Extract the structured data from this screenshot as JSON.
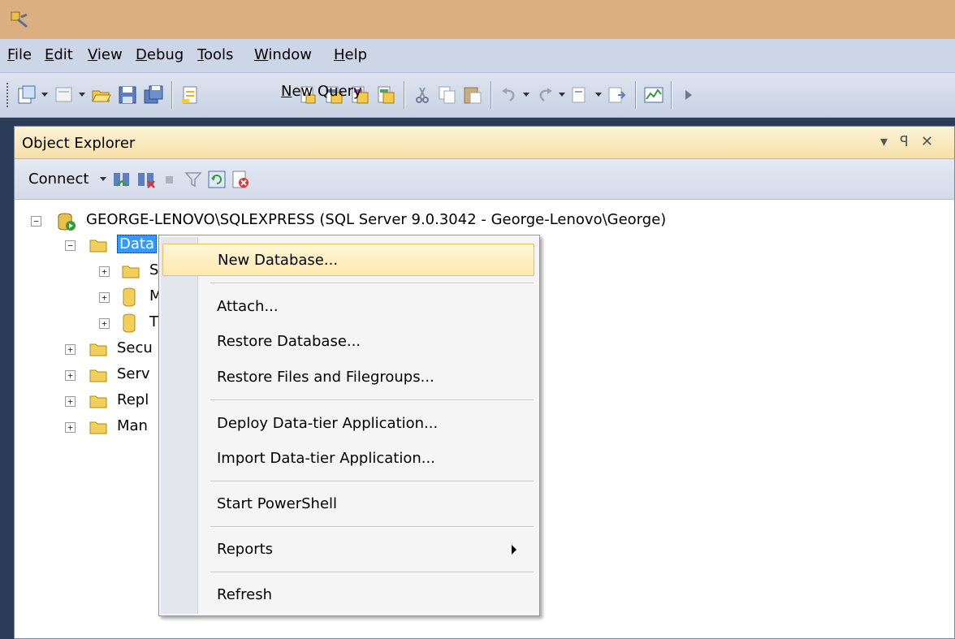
{
  "menubar": {
    "items": [
      {
        "mnemonic": "F",
        "rest": "ile"
      },
      {
        "mnemonic": "E",
        "rest": "dit"
      },
      {
        "mnemonic": "V",
        "rest": "iew"
      },
      {
        "mnemonic": "D",
        "rest": "ebug"
      },
      {
        "mnemonic": "T",
        "rest": "ools"
      },
      {
        "mnemonic": "W",
        "rest": "indow"
      },
      {
        "mnemonic": "H",
        "rest": "elp"
      }
    ]
  },
  "toolbar": {
    "new_query_mnemonic": "N",
    "new_query_rest": "ew Query"
  },
  "object_explorer": {
    "title": "Object Explorer",
    "header_buttons": [
      "▾",
      "ꟼ",
      "✕"
    ],
    "connect_label": "Connect",
    "tree": {
      "server": "GEORGE-LENOVO\\SQLEXPRESS (SQL Server 9.0.3042 - George-Lenovo\\George)",
      "databases": "Data",
      "children": [
        "S",
        "M",
        "T"
      ],
      "siblings": [
        "Secu",
        "Serv",
        "Repl",
        "Man"
      ]
    }
  },
  "context_menu": {
    "items": [
      "New Database...",
      "Attach...",
      "Restore Database...",
      "Restore Files and Filegroups...",
      "Deploy Data-tier Application...",
      "Import Data-tier Application...",
      "Start PowerShell",
      "Reports",
      "Refresh"
    ],
    "hovered": "New Database..."
  },
  "colors": {
    "title_bar": "#dcae80",
    "workspace": "#2b3c59",
    "selection": "#3399ff",
    "hover": "#fde9b1"
  }
}
